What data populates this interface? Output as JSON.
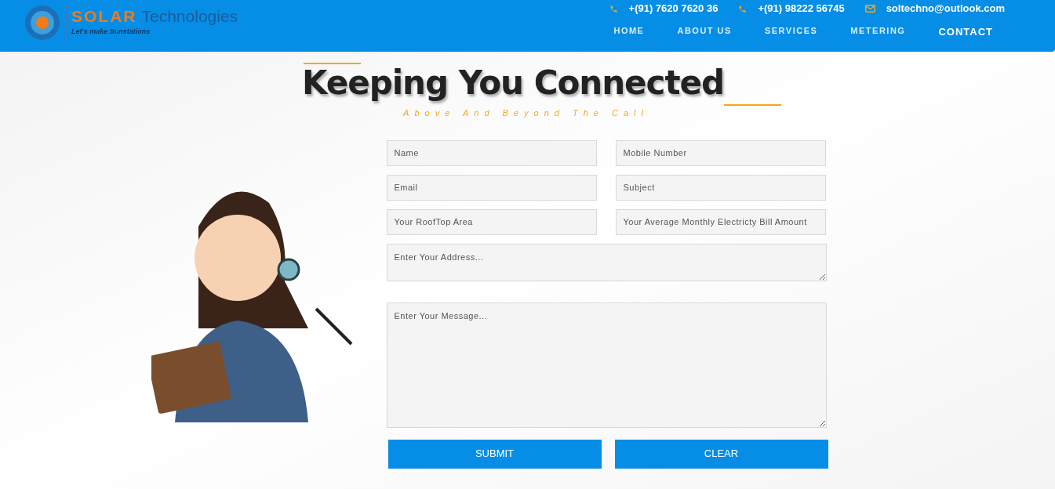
{
  "logo": {
    "brand": "SOLAR",
    "suffix": "Technologies",
    "tagline": "Let's make Sunstations"
  },
  "contacts": [
    {
      "kind": "phone",
      "text": "+(91) 7620 7620 36"
    },
    {
      "kind": "phone",
      "text": "+(91) 98222 56745"
    },
    {
      "kind": "email",
      "text": "soltechno@outlook.com"
    }
  ],
  "nav": [
    {
      "label": "HOME",
      "selected": false
    },
    {
      "label": "ABOUT US",
      "selected": false
    },
    {
      "label": "SERVICES",
      "selected": false
    },
    {
      "label": "METERING",
      "selected": false
    },
    {
      "label": "CONTACT",
      "selected": true
    }
  ],
  "heading": {
    "title": "Keeping You Connected",
    "subtitle": "Above And Beyond The Call"
  },
  "form": {
    "fields": [
      {
        "placeholder": "Name"
      },
      {
        "placeholder": "Mobile Number"
      },
      {
        "placeholder": "Email"
      },
      {
        "placeholder": "Subject"
      },
      {
        "placeholder": "Your RoofTop Area"
      },
      {
        "placeholder": "Your Average Monthly Electricty Bill Amount"
      }
    ],
    "textareas": [
      {
        "placeholder": "Enter Your Address..."
      },
      {
        "placeholder": "Enter Your Message..."
      }
    ],
    "buttons": [
      "SUBMIT",
      "CLEAR"
    ]
  }
}
